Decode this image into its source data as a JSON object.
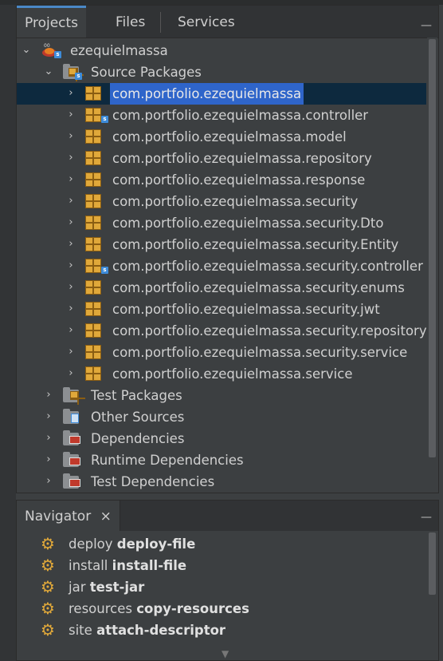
{
  "colors": {
    "background": "#3c3f41",
    "selection": "#2f65ca",
    "selected_row": "#0d293e",
    "package": "#e0a83a",
    "tab_accent": "#4a88c7"
  },
  "tabs": [
    {
      "label": "Projects",
      "active": true
    },
    {
      "label": "Files",
      "active": false
    },
    {
      "label": "Services",
      "active": false
    }
  ],
  "minimize_glyph": "—",
  "project": {
    "name": "ezequielmassa",
    "source_packages": "Source Packages",
    "packages": [
      "com.portfolio.ezequielmassa",
      "com.portfolio.ezequielmassa.controller",
      "com.portfolio.ezequielmassa.model",
      "com.portfolio.ezequielmassa.repository",
      "com.portfolio.ezequielmassa.response",
      "com.portfolio.ezequielmassa.security",
      "com.portfolio.ezequielmassa.security.Dto",
      "com.portfolio.ezequielmassa.security.Entity",
      "com.portfolio.ezequielmassa.security.controller",
      "com.portfolio.ezequielmassa.security.enums",
      "com.portfolio.ezequielmassa.security.jwt",
      "com.portfolio.ezequielmassa.security.repository",
      "com.portfolio.ezequielmassa.security.service",
      "com.portfolio.ezequielmassa.service"
    ],
    "other_nodes": [
      "Test Packages",
      "Other Sources",
      "Dependencies",
      "Runtime Dependencies",
      "Test Dependencies"
    ]
  },
  "navigator": {
    "tab_label": "Navigator",
    "close_glyph": "×",
    "goals": [
      {
        "phase": "deploy",
        "goal": "deploy-file"
      },
      {
        "phase": "install",
        "goal": "install-file"
      },
      {
        "phase": "jar",
        "goal": "test-jar"
      },
      {
        "phase": "resources",
        "goal": "copy-resources"
      },
      {
        "phase": "site",
        "goal": "attach-descriptor"
      }
    ]
  }
}
